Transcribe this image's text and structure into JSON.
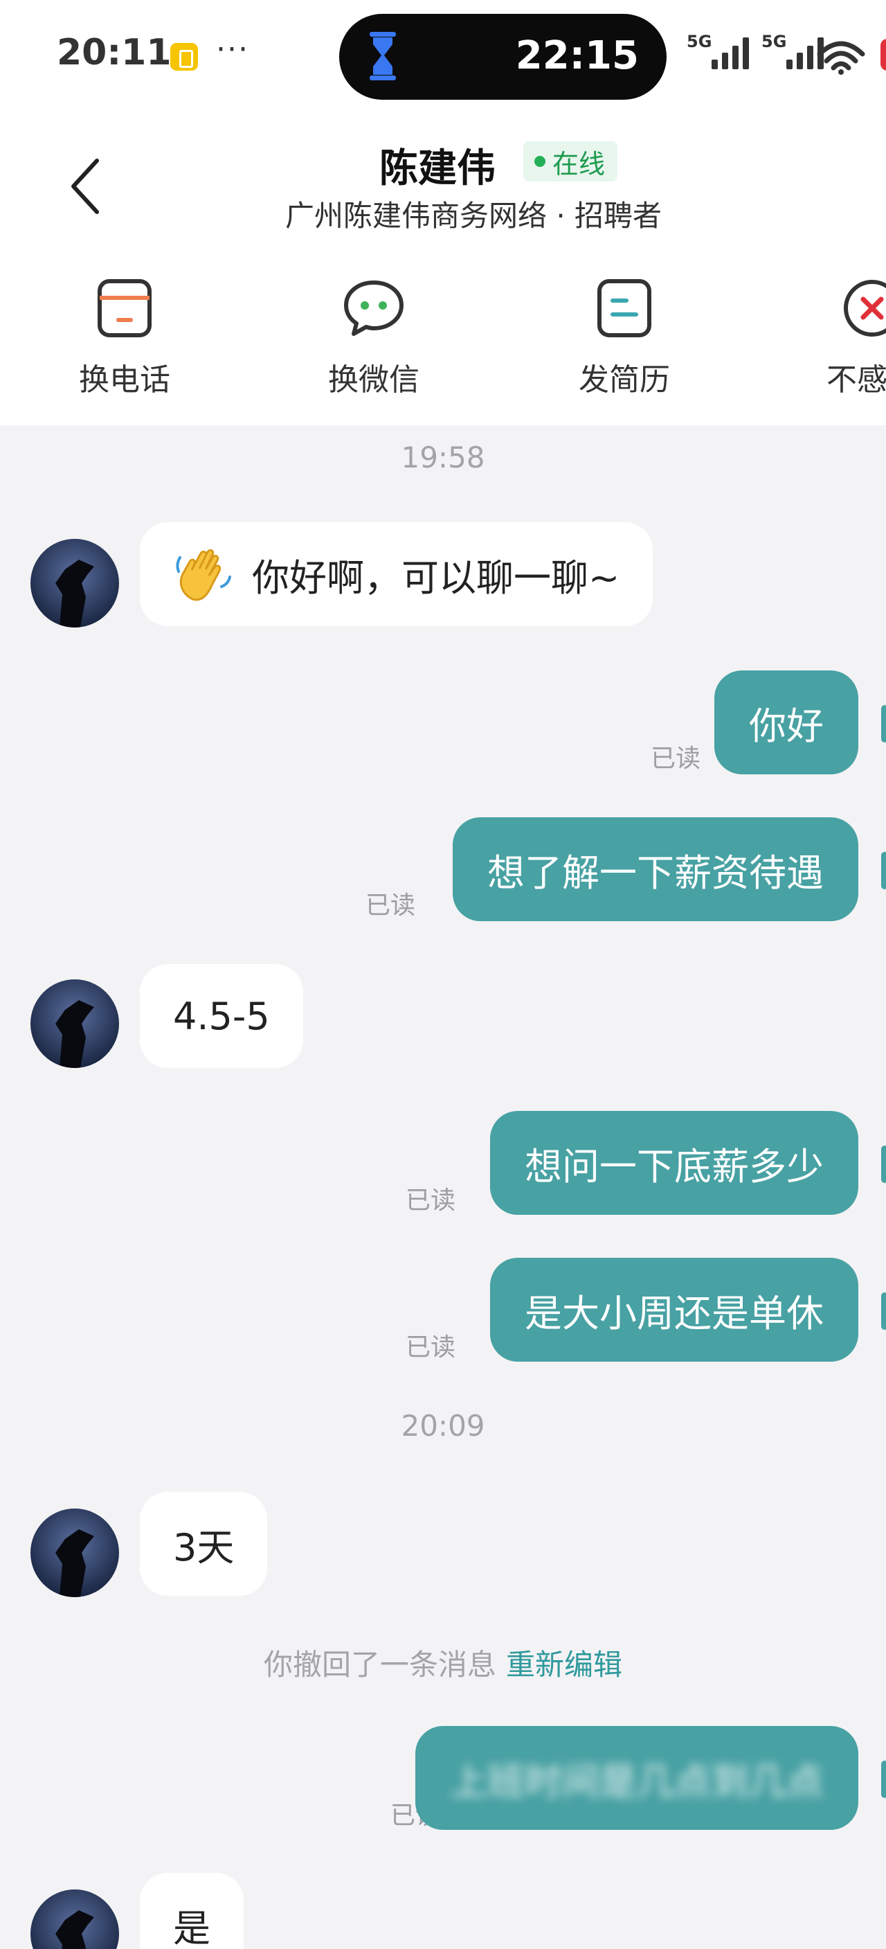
{
  "status_bar": {
    "time": "20:11",
    "more": "···",
    "pill_time": "22:15",
    "signal_1": "5G",
    "signal_2": "5G",
    "accent_app_color": "#f6c400"
  },
  "header": {
    "contact_name": "陈建伟",
    "online_status": "在线",
    "company_line": "广州陈建伟商务网络 · 招聘者"
  },
  "actions": [
    {
      "label": "换电话",
      "icon": "phone-card-icon"
    },
    {
      "label": "换微信",
      "icon": "wechat-bubble-icon"
    },
    {
      "label": "发简历",
      "icon": "resume-icon"
    },
    {
      "label": "不感兴",
      "icon": "not-interested-icon"
    }
  ],
  "chat": {
    "timestamp_1": "19:58",
    "timestamp_2": "20:09",
    "read_label": "已读",
    "messages": [
      {
        "from": "them",
        "text": "你好啊，可以聊一聊~",
        "icon": "waving-hand-icon"
      },
      {
        "from": "me",
        "text": "你好",
        "status": "已读"
      },
      {
        "from": "me",
        "text": "想了解一下薪资待遇",
        "status": "已读"
      },
      {
        "from": "them",
        "text": "4.5-5"
      },
      {
        "from": "me",
        "text": "想问一下底薪多少",
        "status": "已读"
      },
      {
        "from": "me",
        "text": "是大小周还是单休",
        "status": "已读"
      },
      {
        "from": "them",
        "text": "3天"
      },
      {
        "from": "me",
        "text": "上班时间是几点到几点",
        "status": "已读"
      },
      {
        "from": "them",
        "text": "是"
      }
    ],
    "recall_text": "你撤回了一条消息",
    "recall_action": "重新编辑"
  },
  "colors": {
    "outgoing_bubble": "#48a1a3",
    "incoming_bubble": "#ffffff",
    "background": "#f3f3f5",
    "online_green": "#25b058",
    "link_teal": "#2f9a9d"
  }
}
